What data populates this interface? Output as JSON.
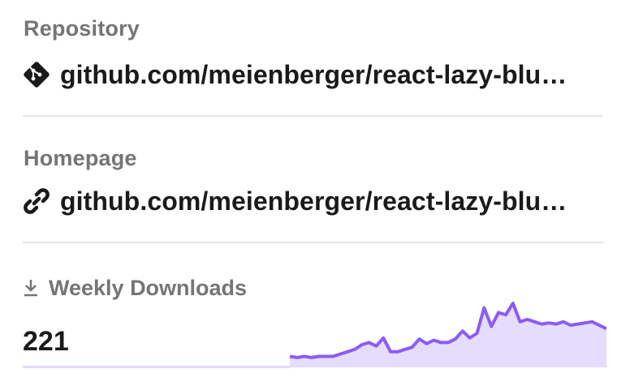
{
  "repository": {
    "title": "Repository",
    "url": "github.com/meienberger/react-lazy-blu…",
    "icon": "git-icon"
  },
  "homepage": {
    "title": "Homepage",
    "url": "github.com/meienberger/react-lazy-blu…",
    "icon": "link-icon"
  },
  "downloads": {
    "label": "Weekly Downloads",
    "count": "221",
    "icon": "download-icon",
    "chart_data": {
      "type": "area",
      "values": [
        6,
        5,
        6,
        5,
        6,
        6,
        6,
        8,
        10,
        12,
        16,
        18,
        15,
        22,
        10,
        10,
        12,
        14,
        21,
        17,
        20,
        18,
        18,
        21,
        28,
        22,
        26,
        48,
        32,
        44,
        42,
        52,
        36,
        38,
        36,
        34,
        35,
        34,
        36,
        33,
        34,
        35,
        36,
        33,
        30
      ],
      "line_color": "#8b5cf6",
      "fill_color": "#e6dcfd"
    }
  },
  "colors": {
    "label": "#757575",
    "text": "#1a1a1a",
    "divider": "#e5e5e5",
    "accent": "#8b5cf6"
  }
}
